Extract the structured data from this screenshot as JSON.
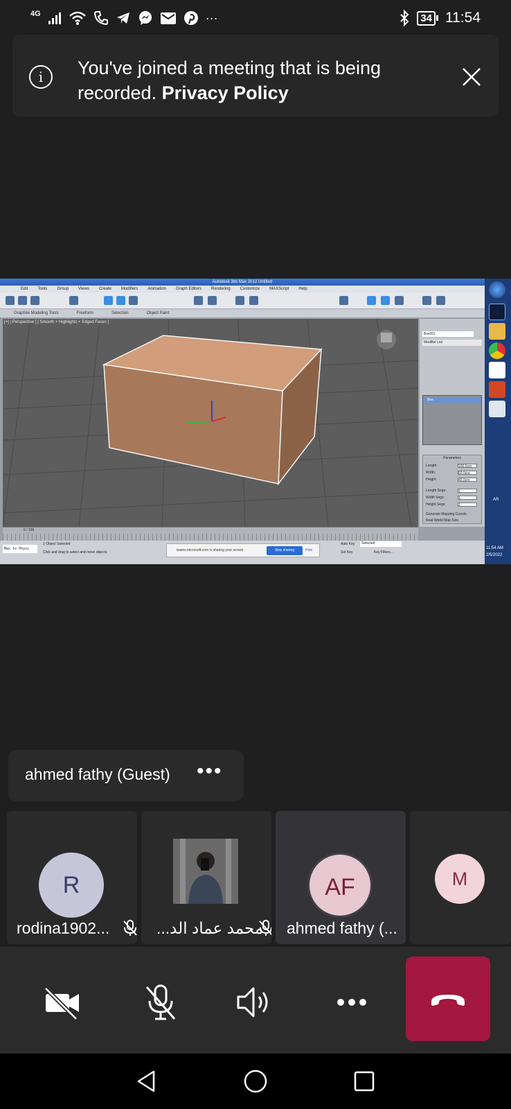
{
  "status_bar": {
    "network": "4G",
    "battery": "34",
    "time": "11:54",
    "overflow": "···",
    "icons": [
      "signal-icon",
      "wifi-icon",
      "phone-icon",
      "telegram-icon",
      "messenger-icon",
      "mail-icon",
      "pinterest-icon",
      "bluetooth-icon",
      "battery-icon"
    ]
  },
  "banner": {
    "text": "You've joined a meeting that is being recorded.",
    "link": "Privacy Policy",
    "icon": "info-icon",
    "close_icon": "close-icon"
  },
  "shared_screen": {
    "title": "Autodesk 3ds Max 2012      Untitled",
    "menu": [
      "Edit",
      "Tools",
      "Group",
      "Views",
      "Create",
      "Modifiers",
      "Animation",
      "Graph Editors",
      "Rendering",
      "Customize",
      "MAXScript",
      "Help"
    ],
    "ribbon_tabs": [
      "Graphite Modeling Tools",
      "Freeform",
      "Selection",
      "Object Paint"
    ],
    "viewport_label": "[+] [ Perspective ] [ Smooth + Highlights + Edged Faces ]",
    "object_name": "Box001",
    "modifier_list": "Modifier List",
    "stack_item": "Box",
    "parameters_title": "Parameters",
    "param_labels": [
      "Length:",
      "Width:",
      "Height:",
      "Length Segs:",
      "Width Segs:",
      "Height Segs:"
    ],
    "param_values": [
      "100.0cm",
      "60.0cm",
      "40.0cm",
      "1",
      "1",
      "1"
    ],
    "checkbox_labels": [
      "Generate Mapping Coords.",
      "Real-World Map Size"
    ],
    "frame_counter": "0 / 100",
    "status": "1 Object Selected",
    "prompt": "Click and drag to select and move objects",
    "script_box": "Max to Physc",
    "share_notice": "teams.microsoft.com is sharing your screen.",
    "stop_sharing": "Stop sharing",
    "hide": "Hide",
    "auto_key": "Auto Key",
    "set_key": "Set Key",
    "selected": "Selected",
    "key_filters": "Key Filters...",
    "clock_time": "11:54 AM",
    "clock_date": "2/5/2022",
    "lang": "AR"
  },
  "participant_pill": {
    "name": "ahmed fathy (Guest)",
    "more": "•••"
  },
  "tiles": [
    {
      "initials": "R",
      "name": "rodina1902...",
      "avatar_bg": "#c5c7d9",
      "avatar_fg": "#3b3a6b"
    },
    {
      "initials": "",
      "name": "محمد عماد الد...",
      "avatar_bg": "#5a5a5a",
      "avatar_fg": "#ffffff"
    },
    {
      "initials": "AF",
      "name": "ahmed fathy (...",
      "avatar_bg": "#e8c8d1",
      "avatar_fg": "#7a1f3c"
    },
    {
      "initials": "M",
      "name": "",
      "avatar_bg": "#f2d5da",
      "avatar_fg": "#8a2a44"
    }
  ],
  "controls": {
    "camera": "camera-off-icon",
    "mic": "mic-off-icon",
    "speaker": "speaker-icon",
    "more": "more-icon",
    "hangup": "hang-up-icon"
  },
  "colors": {
    "background": "#1f1f1f",
    "banner": "#272727",
    "hangup": "#a4173e",
    "tile": "#2a2a2a",
    "tile_active": "#343438"
  }
}
